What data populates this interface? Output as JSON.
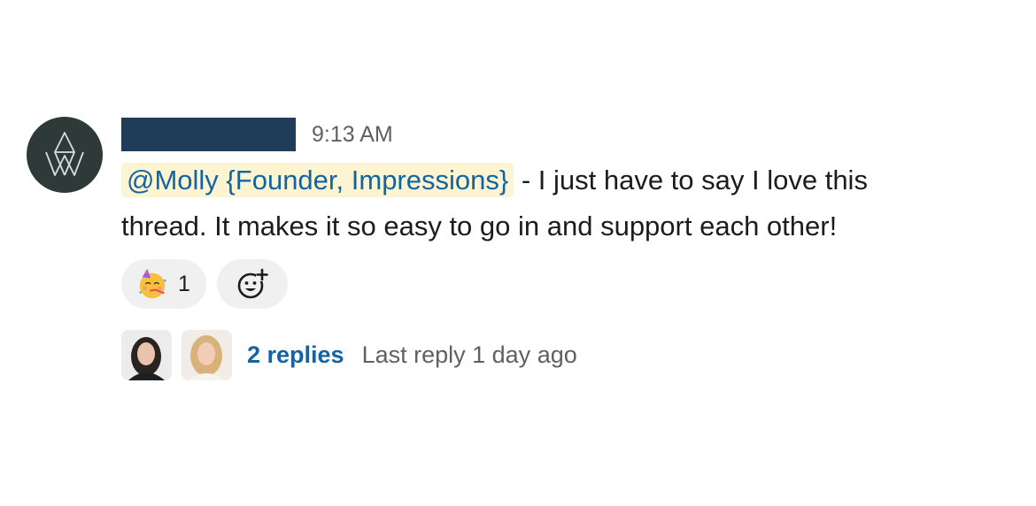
{
  "message": {
    "timestamp": "9:13 AM",
    "mention": "@Molly {Founder, Impressions}",
    "text_line1": " - I just have to say I love this",
    "text_line2": "thread. It makes it so easy to go in and support each other!"
  },
  "reactions": [
    {
      "icon": "partying-face-icon",
      "count": "1"
    }
  ],
  "thread": {
    "replies_label": "2 replies",
    "last_reply_label": "Last reply 1 day ago"
  },
  "colors": {
    "mention_bg": "#fdf5d1",
    "link": "#1264a3",
    "redaction": "#1f3c58",
    "org_avatar": "#2e3a37"
  }
}
